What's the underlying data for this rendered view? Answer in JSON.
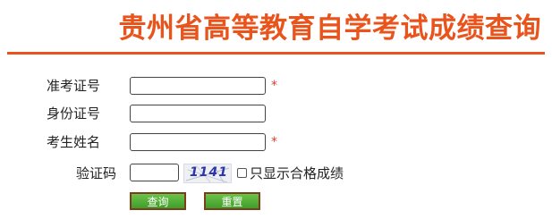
{
  "header": {
    "title": "贵州省高等教育自学考试成绩查询",
    "accent_color": "#e8541c"
  },
  "form": {
    "fields": [
      {
        "label": "准考证号",
        "value": "",
        "required": true,
        "required_mark": "*"
      },
      {
        "label": "身份证号",
        "value": "",
        "required": false
      },
      {
        "label": "考生姓名",
        "value": "",
        "required": true,
        "required_mark": "*"
      },
      {
        "label": "验证码",
        "value": ""
      }
    ],
    "captcha_text": "1141",
    "checkbox_label": "只显示合格成绩",
    "checkbox_checked": false,
    "buttons": {
      "query": "查询",
      "reset": "重置"
    }
  },
  "colors": {
    "required": "#e23b2f",
    "button_fill": "#4caf32",
    "button_border": "#7a3f1a"
  }
}
